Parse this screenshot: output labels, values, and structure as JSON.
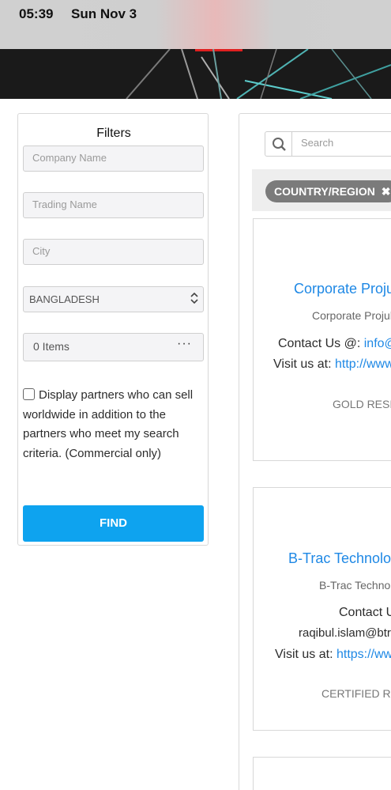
{
  "status": {
    "time": "05:39",
    "date": "Sun Nov 3"
  },
  "filters": {
    "title": "Filters",
    "company_placeholder": "Company Name",
    "trading_placeholder": "Trading Name",
    "city_placeholder": "City",
    "country_value": "BANGLADESH",
    "items_value": "0 Items",
    "worldwide_label": "Display partners who can sell worldwide in addition to the partners who meet my search criteria. (Commercial only)",
    "find_label": "FIND"
  },
  "search": {
    "placeholder": "Search"
  },
  "active_filter": {
    "label": "COUNTRY/REGION"
  },
  "results": [
    {
      "name": "Corporate Proju",
      "trading": "Corporate Projul",
      "contact_label": "Contact Us @:",
      "contact_value": "info@p",
      "visit_label": "Visit us at:",
      "visit_value": "http://www",
      "tier": "GOLD RESI"
    },
    {
      "name": "B-Trac Technolog",
      "trading": "B-Trac Technol",
      "contact_label": "Contact U",
      "contact_value": "raqibul.islam@btr",
      "visit_label": "Visit us at:",
      "visit_value": "https://ww",
      "tier": "CERTIFIED RE"
    }
  ],
  "colors": {
    "accent": "#0ea3ef",
    "link": "#1e88e5",
    "tag": "#7b7b7b"
  }
}
